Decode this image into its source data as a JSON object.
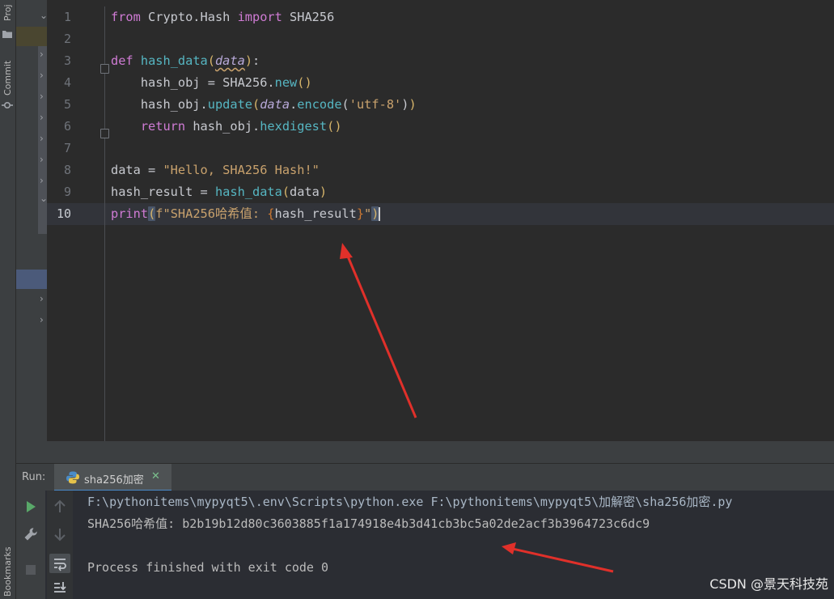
{
  "tool_windows": {
    "project_label": "Proj",
    "commit_label": "Commit",
    "bookmarks_label": "Bookmarks"
  },
  "editor": {
    "active_line": 10,
    "line_numbers": [
      "1",
      "2",
      "3",
      "4",
      "5",
      "6",
      "7",
      "8",
      "9",
      "10"
    ],
    "lines": {
      "l1": {
        "kw1": "from",
        "t1": " Crypto.Hash ",
        "kw2": "import",
        "t2": " SHA256"
      },
      "l3": {
        "kw1": "def",
        "sp": " ",
        "fn": "hash_data",
        "po": "(",
        "param": "data",
        "pc": ")",
        "colon": ":"
      },
      "l4": {
        "indent": "    ",
        "t1": "hash_obj = SHA256.",
        "fn": "new",
        "po": "(",
        "pc": ")"
      },
      "l5": {
        "indent": "    ",
        "t1": "hash_obj.",
        "fn": "update",
        "po": "(",
        "param": "data",
        "dot": ".",
        "fn2": "encode",
        "po2": "(",
        "str": "'utf-8'",
        "pc2": ")",
        "pc": ")"
      },
      "l6": {
        "indent": "    ",
        "kw": "return",
        "t1": " hash_obj.",
        "fn": "hexdigest",
        "po": "(",
        "pc": ")"
      },
      "l8": {
        "t1": "data = ",
        "str": "\"Hello, SHA256 Hash!\""
      },
      "l9": {
        "t1": "hash_result = ",
        "fn": "hash_data",
        "po": "(",
        "arg": "data",
        "pc": ")"
      },
      "l10": {
        "fn": "print",
        "po": "(",
        "fpre": "f",
        "str1": "\"SHA256哈希值: ",
        "bo": "{",
        "var": "hash_result",
        "bc": "}",
        "str2": "\"",
        "pc": ")"
      }
    }
  },
  "run_panel": {
    "label": "Run:",
    "tab_label": "sha256加密",
    "output": [
      "F:\\pythonitems\\mypyqt5\\.env\\Scripts\\python.exe F:\\pythonitems\\mypyqt5\\加解密\\sha256加密.py",
      "SHA256哈希值: b2b19b12d80c3603885f1a174918e4b3d41cb3bc5a02de2acf3b3964723c6dc9",
      "",
      "Process finished with exit code 0"
    ]
  },
  "watermark": "CSDN @景天科技苑",
  "colors": {
    "keyword": "#cf7bd4",
    "function": "#56b6c2",
    "string": "#c9a26d",
    "annotation_arrow": "#e0302a",
    "run_green": "#59a869"
  }
}
